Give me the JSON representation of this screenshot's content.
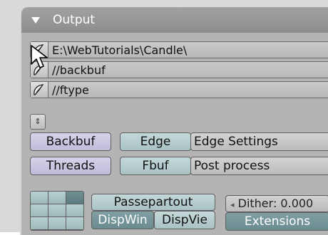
{
  "panel": {
    "title": "Output",
    "paths": [
      {
        "value": "E:\\WebTutorials\\Candle\\"
      },
      {
        "value": "//backbuf"
      },
      {
        "value": "//ftype"
      }
    ]
  },
  "buttons": {
    "backbuf": "Backbuf",
    "threads": "Threads",
    "edge": "Edge",
    "edge_settings": "Edge Settings",
    "fbuf": "Fbuf",
    "post_process": "Post process",
    "passepartout": "Passepartout",
    "dispwin": "DispWin",
    "dispview": "DispVie",
    "extensions": "Extensions",
    "stepper_glyph": "⇕"
  },
  "dither": {
    "label": "Dither: 0.000"
  },
  "icons": {
    "panel_toggle": "triangle-down-icon",
    "file_browse": "folder-browse-icon",
    "cursor": "mouse-pointer-icon"
  }
}
